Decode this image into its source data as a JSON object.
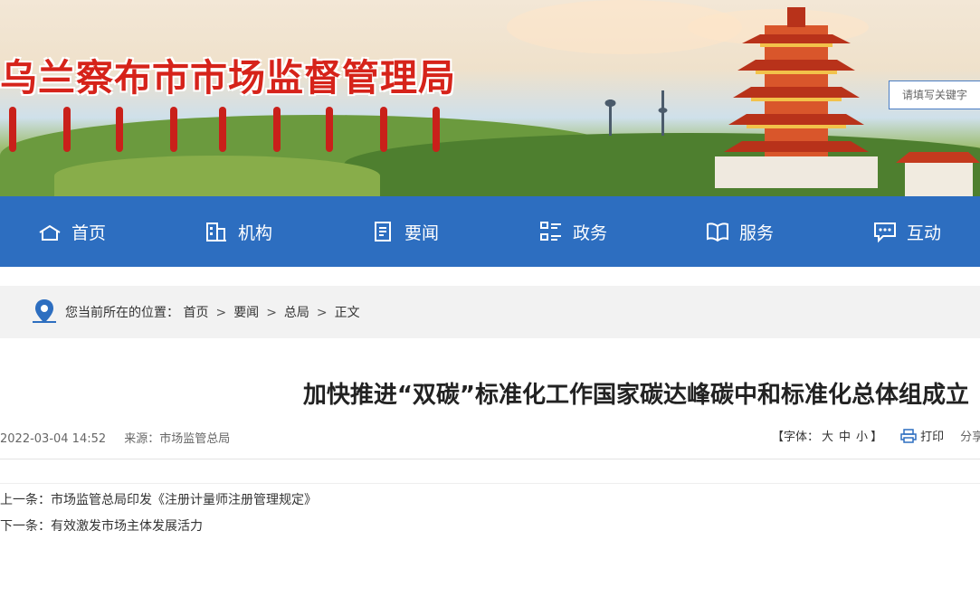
{
  "header": {
    "site_title": "乌兰察布市市场监督管理局",
    "search_placeholder": "请填写关键字",
    "title_color": "#d6231a"
  },
  "nav": {
    "color": "#2d6ec0",
    "items": [
      {
        "label": "首页",
        "icon": "home-icon"
      },
      {
        "label": "机构",
        "icon": "building-icon"
      },
      {
        "label": "要闻",
        "icon": "document-icon"
      },
      {
        "label": "政务",
        "icon": "list-grid-icon"
      },
      {
        "label": "服务",
        "icon": "open-book-icon"
      },
      {
        "label": "互动",
        "icon": "chat-bubble-icon"
      }
    ]
  },
  "breadcrumb": {
    "prefix": "您当前所在的位置：",
    "items": [
      "首页",
      "要闻",
      "总局",
      "正文"
    ],
    "separator": ">"
  },
  "article": {
    "title": "加快推进“双碳”标准化工作国家碳达峰碳中和标准化总体组成立",
    "date": "2022-03-04 14:52",
    "source": "来源：市场监管总局",
    "font_label_open": "【字体：",
    "font_large": "大",
    "font_medium": "中",
    "font_small": "小",
    "font_label_close": "】",
    "print_label": "打印",
    "share_label": "分享"
  },
  "pagination": {
    "prev_label": "上一条：",
    "prev_title": "市场监管总局印发《注册计量师注册管理规定》",
    "next_label": "下一条：",
    "next_title": "有效激发市场主体发展活力"
  }
}
